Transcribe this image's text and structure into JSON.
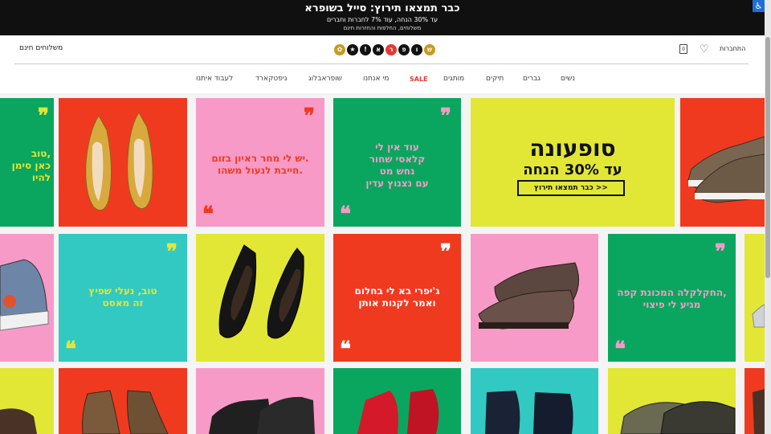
{
  "announcement": {
    "title": "כבר תמצאו תירוץ: סייל בשופרא",
    "line2": "עד 30% הנחה, עוד 7% לחברות וחברים",
    "line3": "משלוחים, החלפות והחזרות חינם"
  },
  "accessibility_icon": "accessibility-icon",
  "header": {
    "free_shipping": "משלוחים חינם",
    "login": "התחברות",
    "heart_icon": "heart-icon",
    "bag_icon": "shopping-bag-icon",
    "bag_count": "0",
    "logo_letters": [
      "ש",
      "ו",
      "פ",
      "ר",
      "א",
      "!",
      "★",
      "✿"
    ]
  },
  "nav": [
    "נשים",
    "גברים",
    "תיקים",
    "מותגים",
    "SALE",
    "מי אנחנו",
    "שופראבלוג",
    "גיפטקארד",
    "לעבוד איתנו"
  ],
  "colors": {
    "green": "#0aa55e",
    "red": "#f03a1f",
    "pink": "#f79ac8",
    "yellow": "#e2e635",
    "teal": "#33c9c3",
    "topbar": "#101010"
  },
  "tiles": {
    "r1_partial_text": "טוב,\nכאן סימן\nלהיו",
    "r1_quote_pink": "יש לי מחר ראיון בזום.\nחייבת לנעול משהו.",
    "r1_quote_green": "עוד אין לי\nקלאסי שחור\nנחש מט\nעם נצנוץ עדין",
    "promo_title": "סופעונה",
    "promo_sub": "עד 30% הנחה",
    "promo_button": "כבר תמצאו תירוץ >>",
    "r2_quote_teal": "טוב, נעלי שפיץ\nזה מאסט",
    "r2_quote_red": "ג'יפרי בא לי בחלום\nואמר לקנות אותן",
    "r2_quote_green": "החקלקלה המכונת קפה,\nמגיע לי פיצוי"
  },
  "quote_open": "❞",
  "quote_close": "❝"
}
